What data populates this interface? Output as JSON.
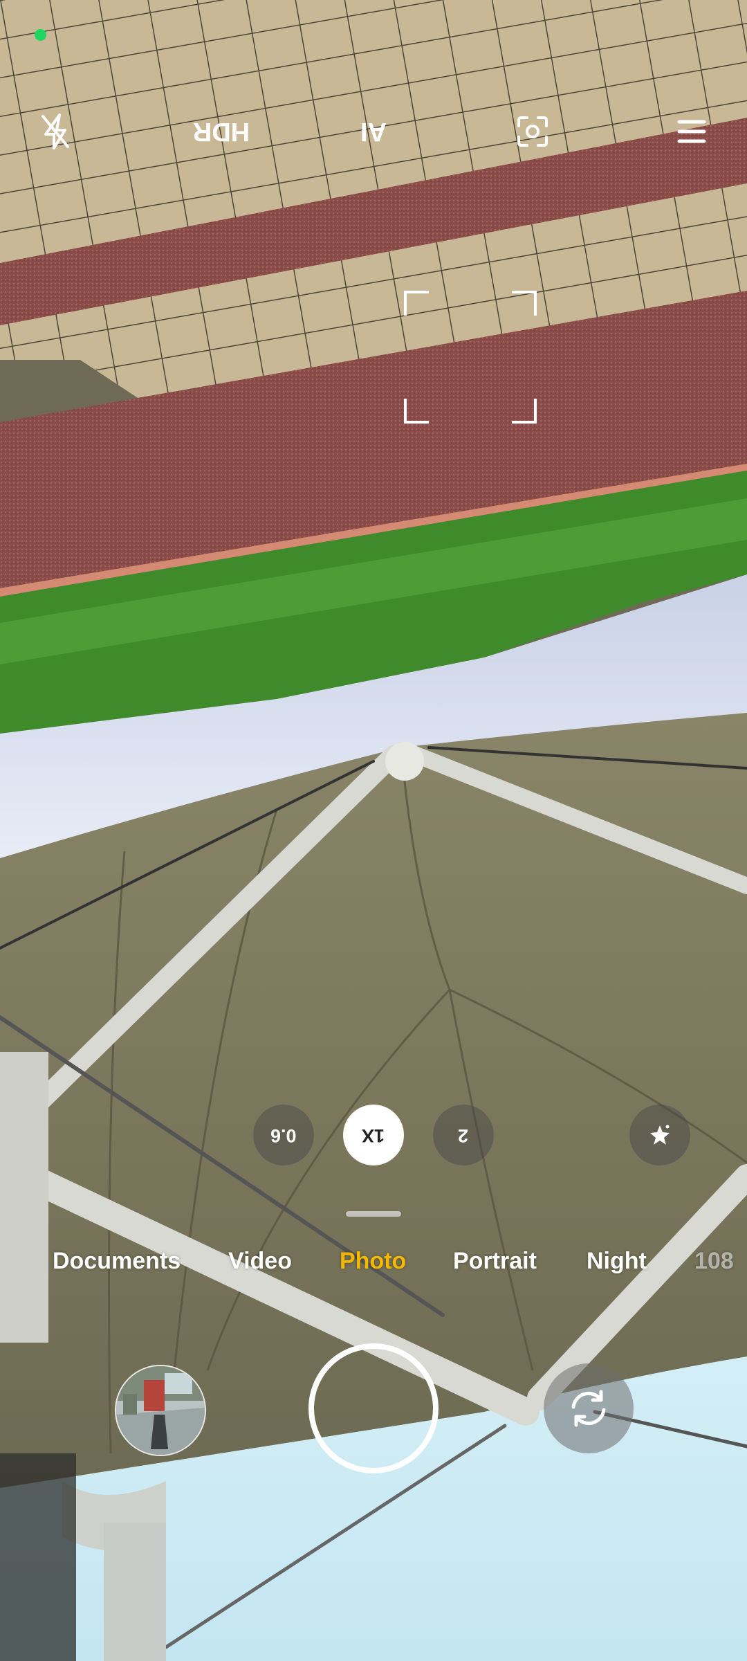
{
  "status": {
    "camera_indicator_color": "#1fd65f"
  },
  "top_bar": {
    "flash_icon": "flash-off-icon",
    "hdr_label": "HDR",
    "ai_label": "AI",
    "lens_icon": "lens-scan-icon",
    "menu_icon": "menu-icon"
  },
  "focus_frame": {
    "visible": true
  },
  "zoom": {
    "options": [
      "0.6",
      "1X",
      "2"
    ],
    "selected": "1X",
    "effects_icon": "star-effects-icon"
  },
  "modes": {
    "items": [
      "Documents",
      "Video",
      "Photo",
      "Portrait",
      "Night",
      "108"
    ],
    "selected": "Photo",
    "accent_color": "#f5b800"
  },
  "bottom_bar": {
    "gallery_icon": "gallery-thumbnail",
    "shutter_icon": "shutter-button",
    "switch_icon": "switch-camera-icon"
  }
}
